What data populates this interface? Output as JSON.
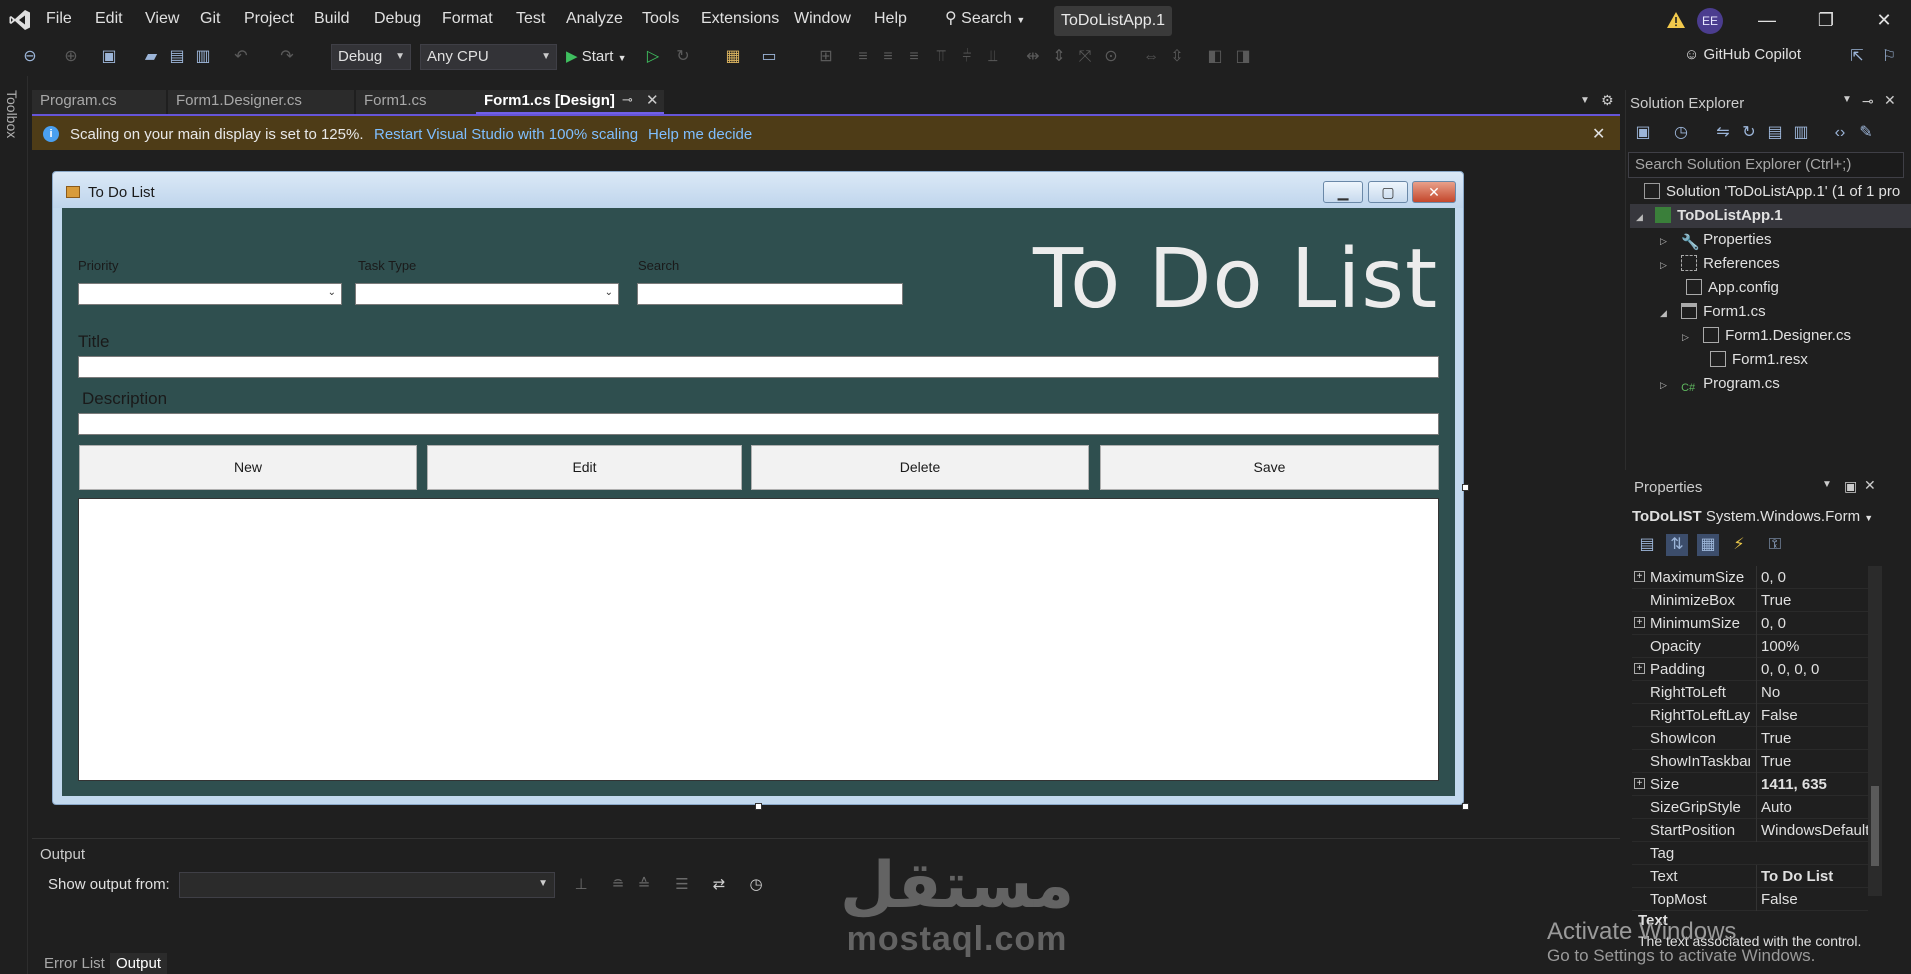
{
  "menubar": {
    "items": [
      "File",
      "Edit",
      "View",
      "Git",
      "Project",
      "Build",
      "Debug",
      "Format",
      "Test",
      "Analyze",
      "Tools",
      "Extensions",
      "Window",
      "Help"
    ],
    "search_label": "Search",
    "solution_title": "ToDoListApp.1",
    "avatar_initials": "EE"
  },
  "toolbar": {
    "config": "Debug",
    "platform": "Any CPU",
    "start_label": "Start",
    "copilot_label": "GitHub Copilot"
  },
  "toolbox_label": "Toolbox",
  "doc_tabs": [
    {
      "label": "Program.cs",
      "active": false
    },
    {
      "label": "Form1.Designer.cs",
      "active": false
    },
    {
      "label": "Form1.cs",
      "active": false
    },
    {
      "label": "Form1.cs [Design]",
      "active": true
    }
  ],
  "infobar": {
    "message": "Scaling on your main display is set to 125%.",
    "link_restart": "Restart Visual Studio with 100% scaling",
    "link_help": "Help me decide"
  },
  "form": {
    "title": "To Do List",
    "heading": "To Do List",
    "priority_label": "Priority",
    "task_type_label": "Task Type",
    "search_label": "Search",
    "title_label": "Title",
    "description_label": "Description",
    "buttons": {
      "new": "New",
      "edit": "Edit",
      "delete": "Delete",
      "save": "Save"
    },
    "client_color": "#2f4f4f"
  },
  "output": {
    "title": "Output",
    "show_from_label": "Show output from:",
    "tabs": {
      "error_list": "Error List",
      "output": "Output"
    }
  },
  "watermark": {
    "arabic": "مستقل",
    "latin": "mostaql.com"
  },
  "solution_explorer": {
    "title": "Solution Explorer",
    "search_placeholder": "Search Solution Explorer (Ctrl+;)",
    "tree": [
      {
        "label": "Solution 'ToDoListApp.1' (1 of 1 pro",
        "icon": "solution-icon"
      },
      {
        "label": "ToDoListApp.1",
        "icon": "csharp-project-icon",
        "selected": true
      },
      {
        "label": "Properties",
        "icon": "wrench-icon"
      },
      {
        "label": "References",
        "icon": "references-icon"
      },
      {
        "label": "App.config",
        "icon": "config-file-icon"
      },
      {
        "label": "Form1.cs",
        "icon": "form-icon"
      },
      {
        "label": "Form1.Designer.cs",
        "icon": "file-icon"
      },
      {
        "label": "Form1.resx",
        "icon": "file-icon"
      },
      {
        "label": "Program.cs",
        "icon": "csharp-file-icon"
      }
    ]
  },
  "properties": {
    "title": "Properties",
    "object_name": "ToDoLIST",
    "object_type": "System.Windows.Form",
    "rows": [
      {
        "name": "MaximumSize",
        "value": "0, 0",
        "expandable": true
      },
      {
        "name": "MinimizeBox",
        "value": "True"
      },
      {
        "name": "MinimumSize",
        "value": "0, 0",
        "expandable": true
      },
      {
        "name": "Opacity",
        "value": "100%"
      },
      {
        "name": "Padding",
        "value": "0, 0, 0, 0",
        "expandable": true
      },
      {
        "name": "RightToLeft",
        "value": "No"
      },
      {
        "name": "RightToLeftLay",
        "value": "False"
      },
      {
        "name": "ShowIcon",
        "value": "True"
      },
      {
        "name": "ShowInTaskbar",
        "value": "True"
      },
      {
        "name": "Size",
        "value": "1411, 635",
        "expandable": true,
        "bold": true
      },
      {
        "name": "SizeGripStyle",
        "value": "Auto"
      },
      {
        "name": "StartPosition",
        "value": "WindowsDefault"
      },
      {
        "name": "Tag",
        "value": ""
      },
      {
        "name": "Text",
        "value": "To Do List",
        "bold": true
      },
      {
        "name": "TopMost",
        "value": "False"
      }
    ],
    "desc_title": "Text",
    "desc_text": "The text associated with the control."
  },
  "activate_windows": {
    "line1": "Activate Windows",
    "line2": "Go to Settings to activate Windows."
  }
}
